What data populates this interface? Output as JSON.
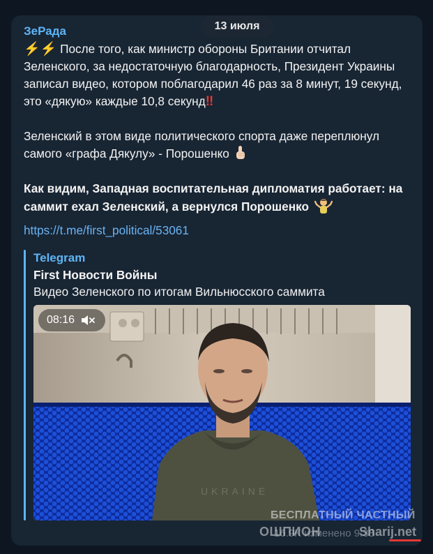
{
  "date_label": "13 июля",
  "message": {
    "sender": "ЗеРада",
    "paragraph1": "После того, как министр обороны Британии отчитал Зеленского, за недостаточную благодарность, Президент Украины записал видео, котором поблагодарил 46 раз за 8 минут, 19 секунд, это «дякую» каждые 10,8 секунд",
    "paragraph1_prefix_emoji": "⚡⚡",
    "paragraph1_suffix_emoji": "‼",
    "paragraph2": "Зеленский в этом виде политического спорта даже переплюнул самого «графа Дякулу» - Порошенко",
    "paragraph2_emoji": "pointing-up-icon",
    "paragraph3": "Как видим, Западная воспитательная дипломатия работает: на саммит ехал Зеленский, а вернулся Порошенко",
    "paragraph3_emoji": "shrug-icon",
    "link": "https://t.me/first_political/53061"
  },
  "preview": {
    "site": "Telegram",
    "title": "First Новости Войны",
    "description": "Видео Зеленского по итогам Вильнюсского саммита",
    "duration": "08:16",
    "muted": true
  },
  "footer": {
    "meta": "16.9K  изменено  9:38",
    "watermark_line1": "БЕСПЛАТНЫЙ ЧАСТНЫЙ",
    "watermark_line2": "ОШПИОН",
    "watermark_site": "Sharij.net"
  },
  "colors": {
    "background": "#0e1621",
    "bubble": "#182533",
    "accent": "#5eb5f7",
    "link": "#6ab3f3"
  }
}
